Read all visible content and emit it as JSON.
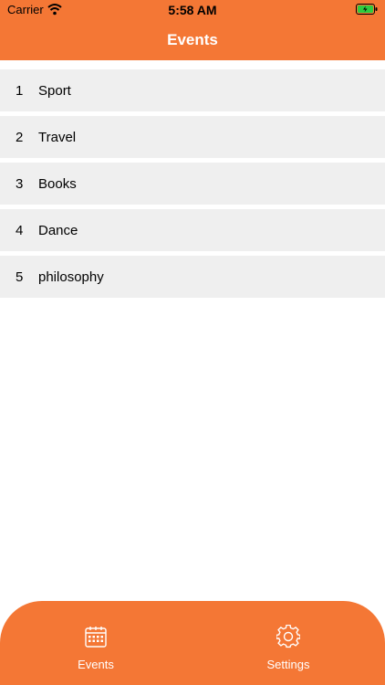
{
  "status_bar": {
    "carrier": "Carrier",
    "time": "5:58 AM"
  },
  "nav": {
    "title": "Events"
  },
  "events": [
    {
      "number": "1",
      "name": "Sport"
    },
    {
      "number": "2",
      "name": "Travel"
    },
    {
      "number": "3",
      "name": "Books"
    },
    {
      "number": "4",
      "name": "Dance"
    },
    {
      "number": "5",
      "name": "philosophy"
    }
  ],
  "tab_bar": {
    "tabs": [
      {
        "label": "Events",
        "icon": "calendar-icon"
      },
      {
        "label": "Settings",
        "icon": "gear-icon"
      }
    ]
  },
  "colors": {
    "accent": "#f47735",
    "row_background": "#efefef",
    "battery_charge": "#2ecc40"
  }
}
